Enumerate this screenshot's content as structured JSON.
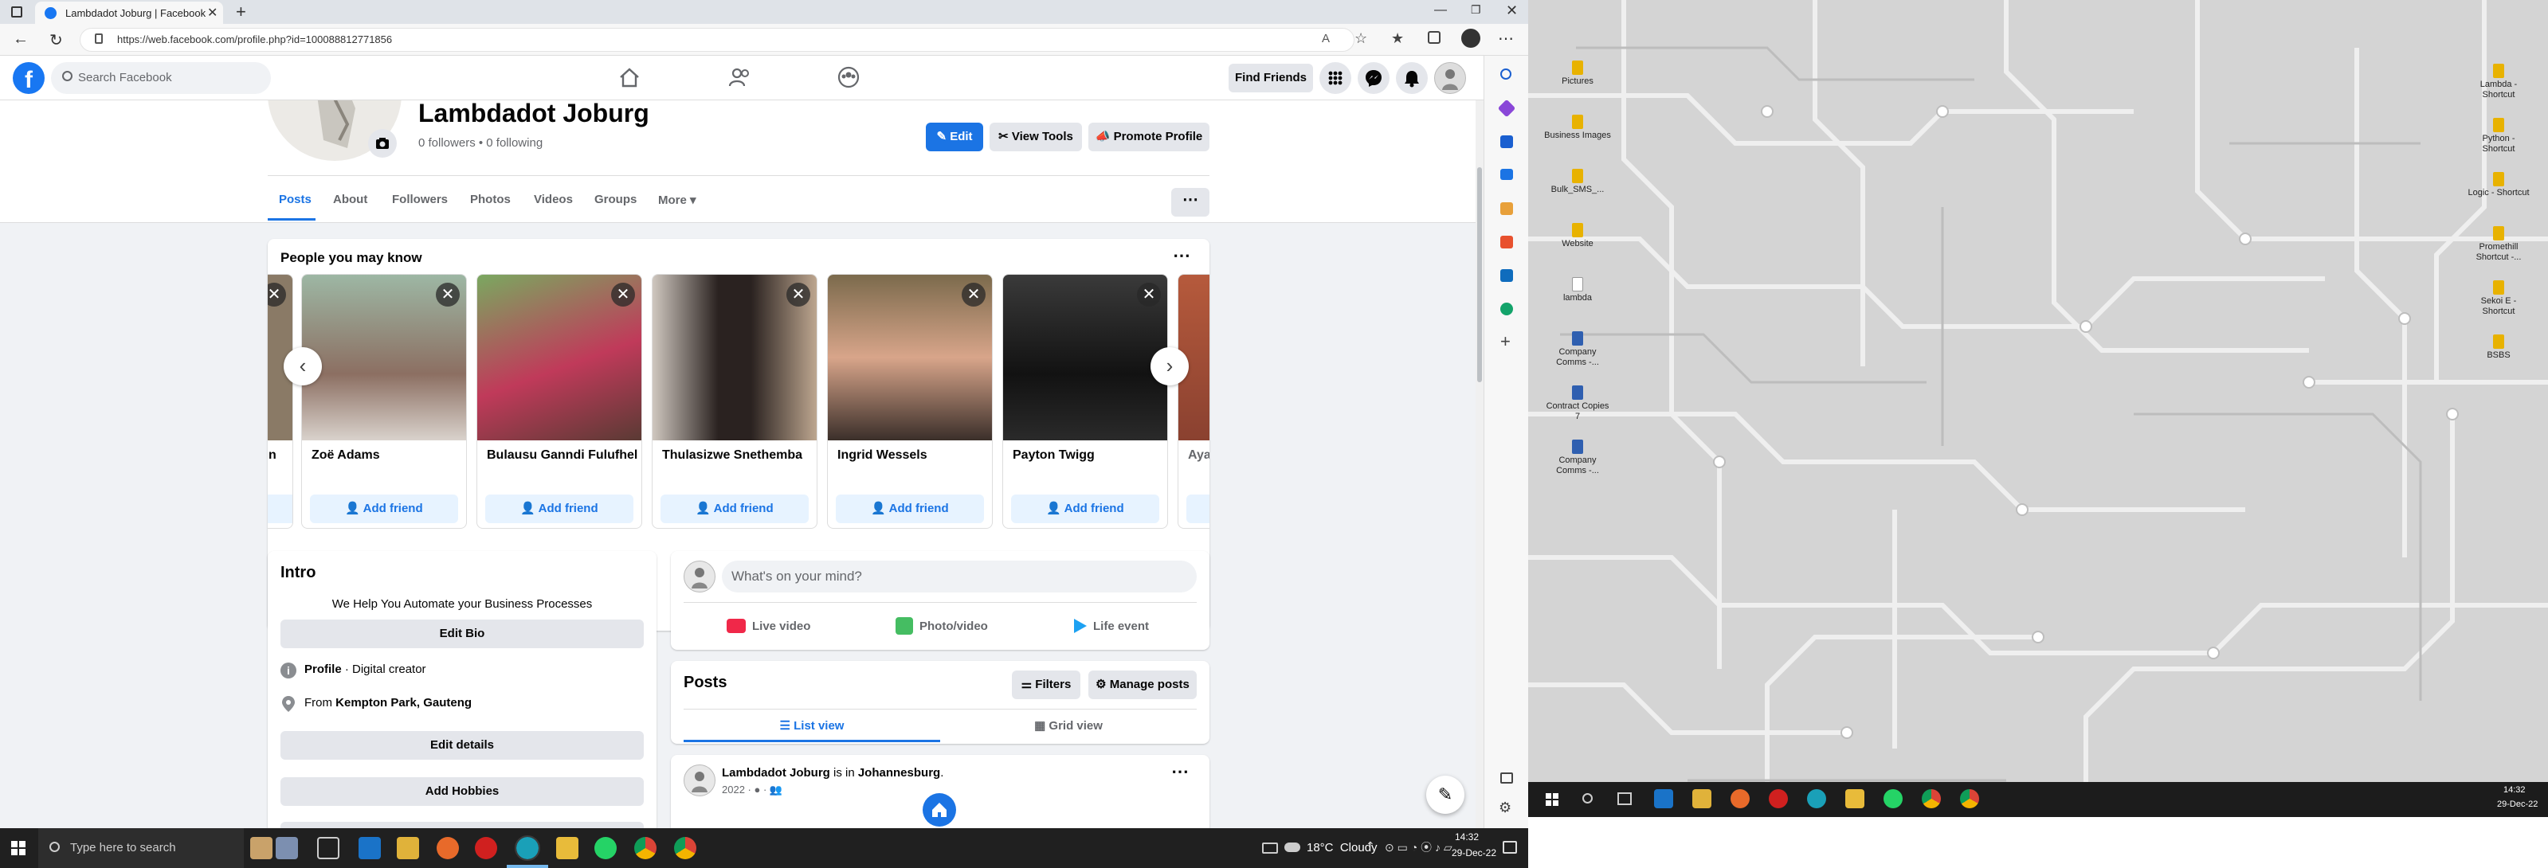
{
  "browser": {
    "tab_title": "Lambdadot Joburg | Facebook",
    "url": "https://web.facebook.com/profile.php?id=100088812771856"
  },
  "fb_nav": {
    "search_placeholder": "Search Facebook",
    "find_friends": "Find Friends"
  },
  "profile": {
    "name": "Lambdadot Joburg",
    "stats": "0 followers • 0 following",
    "edit": "Edit",
    "view_tools": "View Tools",
    "promote": "Promote Profile",
    "tabs": [
      "Posts",
      "About",
      "Followers",
      "Photos",
      "Videos",
      "Groups",
      "More"
    ]
  },
  "pymk": {
    "title": "People you may know",
    "people": [
      {
        "name": "Zoë Adams",
        "action": "Add friend"
      },
      {
        "name": "Bulausu Ganndi Fulufhel",
        "action": "Add friend"
      },
      {
        "name": "Thulasizwe Snethemba",
        "action": "Add friend"
      },
      {
        "name": "Ingrid Wessels",
        "action": "Add friend"
      },
      {
        "name": "Payton Twigg",
        "action": "Add friend"
      }
    ],
    "partial_left": "n",
    "partial_right": "Aya"
  },
  "intro": {
    "title": "Intro",
    "bio": "We Help You Automate your Business Processes",
    "edit_bio": "Edit Bio",
    "profile_label": "Profile",
    "profile_value": " · Digital creator",
    "from_label": "From ",
    "from_value": "Kempton Park, Gauteng",
    "edit_details": "Edit details",
    "add_hobbies": "Add Hobbies"
  },
  "composer": {
    "placeholder": "What's on your mind?",
    "live": "Live video",
    "photo": "Photo/video",
    "life": "Life event"
  },
  "posts": {
    "title": "Posts",
    "filters": "Filters",
    "manage": "Manage posts",
    "list_view": "List view",
    "grid_view": "Grid view",
    "post_author": "Lambdadot Joburg",
    "post_is_in": " is in ",
    "post_place": "Johannesburg",
    "post_dot": ".",
    "post_year": "2022 · "
  },
  "taskbar": {
    "search": "Type here to search",
    "weather": "18°C  Cloudy",
    "time": "14:32",
    "date": "29-Dec-22"
  },
  "desktop": {
    "icons_left": [
      "Pictures",
      "Business Images",
      "Bulk_SMS_...",
      "Website",
      "lambda",
      "Company Comms -...",
      "Contract Copies 7",
      "Company Comms -..."
    ],
    "icons_right": [
      "Lambda - Shortcut",
      "Python - Shortcut",
      "Logic - Shortcut",
      "Promethill Shortcut -...",
      "Sekoi E - Shortcut",
      "BSBS"
    ],
    "time": "14:32",
    "date": "29-Dec-22"
  },
  "colors": {
    "fb_blue": "#1877f2",
    "accent_blue": "#1b74e4",
    "bg": "#f0f2f5"
  }
}
